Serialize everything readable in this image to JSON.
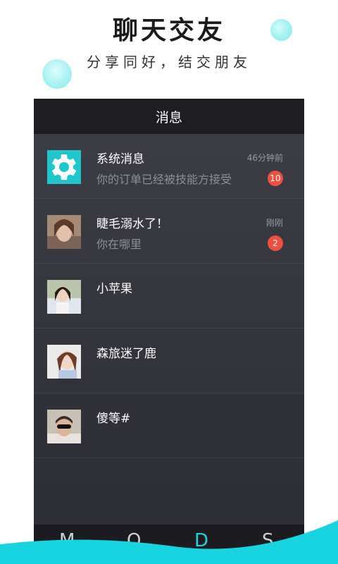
{
  "promo": {
    "headline": "聊天交友",
    "subline": "分享同好，结交朋友"
  },
  "screen": {
    "title": "消息",
    "messages": [
      {
        "name": "系统消息",
        "preview": "你的订单已经被技能方接受",
        "time": "46分钟前",
        "badge": "10",
        "avatar": "gear-icon"
      },
      {
        "name": "睫毛溺水了！",
        "preview": "你在哪里",
        "time": "刚刚",
        "badge": "2",
        "avatar": "user-photo"
      },
      {
        "name": "小苹果",
        "preview": "",
        "time": "",
        "badge": "",
        "avatar": "user-photo"
      },
      {
        "name": "森旅迷了鹿",
        "preview": "",
        "time": "",
        "badge": "",
        "avatar": "user-photo"
      },
      {
        "name": "傻等#",
        "preview": "",
        "time": "",
        "badge": "",
        "avatar": "user-photo"
      }
    ],
    "tabs": [
      "M",
      "Q",
      "D",
      "S"
    ]
  },
  "colors": {
    "accent": "#1fc7cc",
    "badge": "#ef4f3f",
    "titlebar": "#1d1d22",
    "wave": "#18d3e0"
  }
}
